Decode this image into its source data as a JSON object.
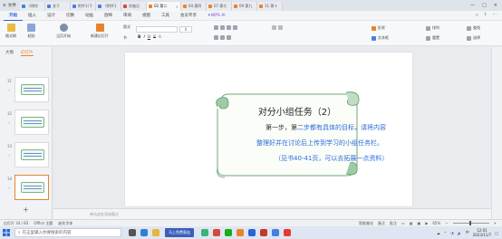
{
  "tabbar": {
    "menu_label": "文件",
    "tabs": [
      {
        "label": "《明伴",
        "color": "blue"
      },
      {
        "label": "关于",
        "color": "blue"
      },
      {
        "label": "附件1(下",
        "color": "blue"
      },
      {
        "label": "《附件1",
        "color": "blue"
      },
      {
        "label": "实施记",
        "color": "red"
      },
      {
        "label": "02.第二",
        "color": "orange",
        "active": true
      },
      {
        "label": "04.第四",
        "color": "orange"
      },
      {
        "label": "07.第七",
        "color": "orange"
      },
      {
        "label": "09.第九",
        "color": "orange"
      },
      {
        "label": "11.第十",
        "color": "orange"
      }
    ]
  },
  "menubar": {
    "items": [
      "开始",
      "插入",
      "设计",
      "切换",
      "动画",
      "放映",
      "审阅",
      "视图",
      "工具",
      "会员专享"
    ],
    "active": "开始",
    "wps_ai": "WPS AI"
  },
  "toolbar": {
    "format_painter": "格式刷",
    "paste": "粘贴",
    "clip": "剪切",
    "from_start": "当页开始",
    "new_slide": "新建幻灯片",
    "layout": "版式",
    "section": "节",
    "reset": "重置",
    "find": "查找",
    "textbox": "文本框",
    "shapes": "形状",
    "arrange": "排列",
    "replace": "替换",
    "select": "选择",
    "font_name": "",
    "font_size": "0",
    "fmt_buttons": [
      "B",
      "I",
      "U",
      "S",
      "A"
    ]
  },
  "left_panel": {
    "tabs": [
      "大纲",
      "幻灯片"
    ],
    "active_tab": "幻灯片",
    "thumb_numbers": [
      "31",
      "32",
      "33",
      "34"
    ],
    "selected_index": 3
  },
  "slide": {
    "title": "对分小组任务（2）",
    "line1_black1": "第一步，第",
    "line1_blue": "二步都有具体的目标，请将内容",
    "line2_blue": "整理好并在讨论后上传到学习的小组任务栏。",
    "line3_blue": "（见书40-41页，可以去拓展一点资料）"
  },
  "notes_placeholder": "单击此处添加备注",
  "status": {
    "slide_pos": "幻灯片 34 / 83",
    "theme": "Office 主题",
    "missing_font": "缺失字体",
    "beautify": "智能美化",
    "notes": "备注",
    "comment": "批注",
    "zoom": "65%"
  },
  "taskbar": {
    "search_placeholder": "在这里输入你要搜索的内容",
    "news": "马上免费直连",
    "time": "12:01",
    "date": "2023/11/7"
  }
}
